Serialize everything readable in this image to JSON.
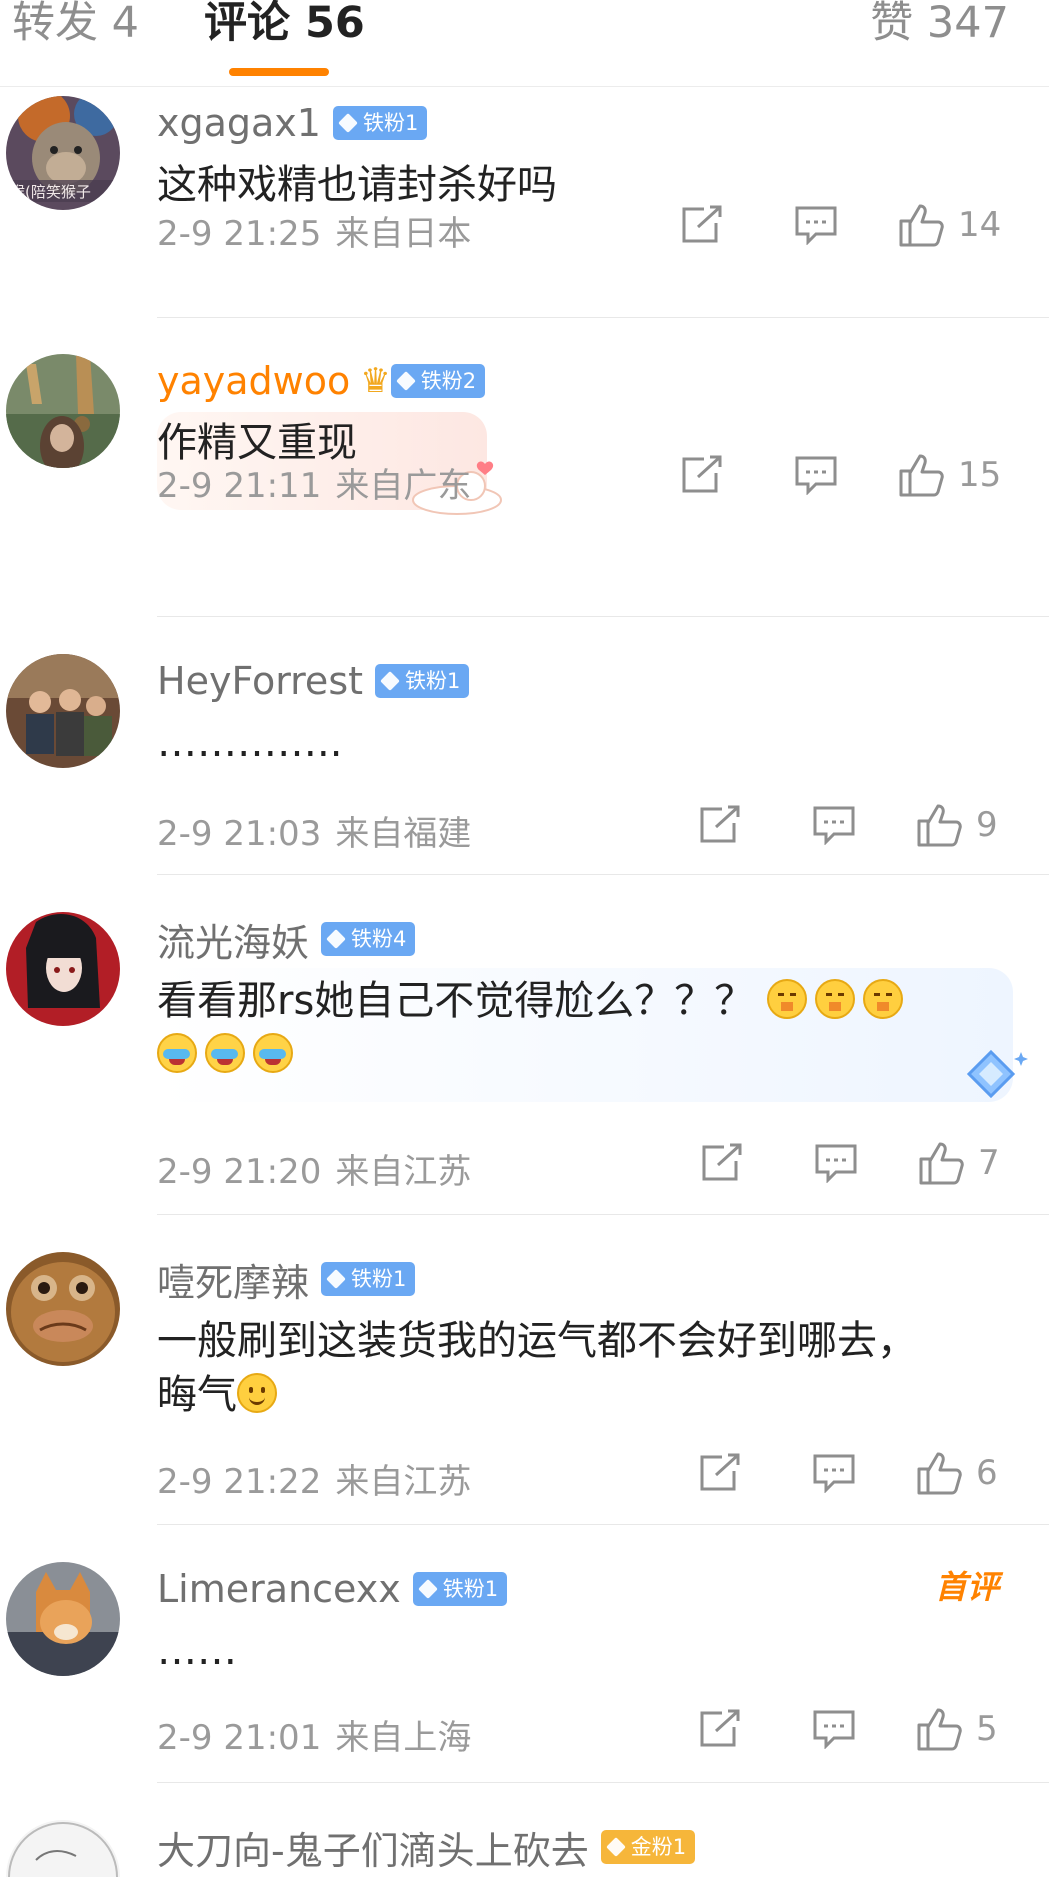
{
  "tabs": {
    "repost": "转发 4",
    "comments": "评论 56",
    "likes": "赞 347"
  },
  "colors": {
    "accent": "#ff8200",
    "badge_blue": "#6aa8f3",
    "badge_gold": "#f6b63a"
  },
  "comments": [
    {
      "user": "xgagax1",
      "badge": "铁粉1",
      "text": "这种戏精也请封杀好吗",
      "time": "2-9 21:25",
      "location": "来自日本",
      "likes": "14",
      "avatar_text": "猴(陪笑猴子"
    },
    {
      "user": "yayadwoo",
      "badge": "铁粉2",
      "text": "作精又重现",
      "time": "2-9 21:11",
      "location": "来自广东",
      "likes": "15",
      "crown_icon": "crown-icon"
    },
    {
      "user": "HeyForrest",
      "badge": "铁粉1",
      "text": "…………..",
      "time": "2-9 21:03",
      "location": "来自福建",
      "likes": "9"
    },
    {
      "user": "流光海妖",
      "badge": "铁粉4",
      "text": "看看那rs她自己不觉得尬么？？？",
      "time": "2-9 21:20",
      "location": "来自江苏",
      "likes": "7",
      "emojis": [
        "shh-emoji",
        "shh-emoji",
        "shh-emoji",
        "cry-laugh-emoji",
        "cry-laugh-emoji",
        "cry-laugh-emoji"
      ]
    },
    {
      "user": "噎死摩辣",
      "badge": "铁粉1",
      "text": "一般刷到这装货我的运气都不会好到哪去，",
      "text2": "晦气",
      "time": "2-9 21:22",
      "location": "来自江苏",
      "likes": "6",
      "emojis": [
        "smile-emoji"
      ]
    },
    {
      "user": "Limerancexx",
      "badge": "铁粉1",
      "text": "……",
      "time": "2-9 21:01",
      "location": "来自上海",
      "likes": "5",
      "tag": "首评"
    },
    {
      "user": "大刀向-鬼子们滴头上砍去",
      "badge": "金粉1"
    }
  ]
}
